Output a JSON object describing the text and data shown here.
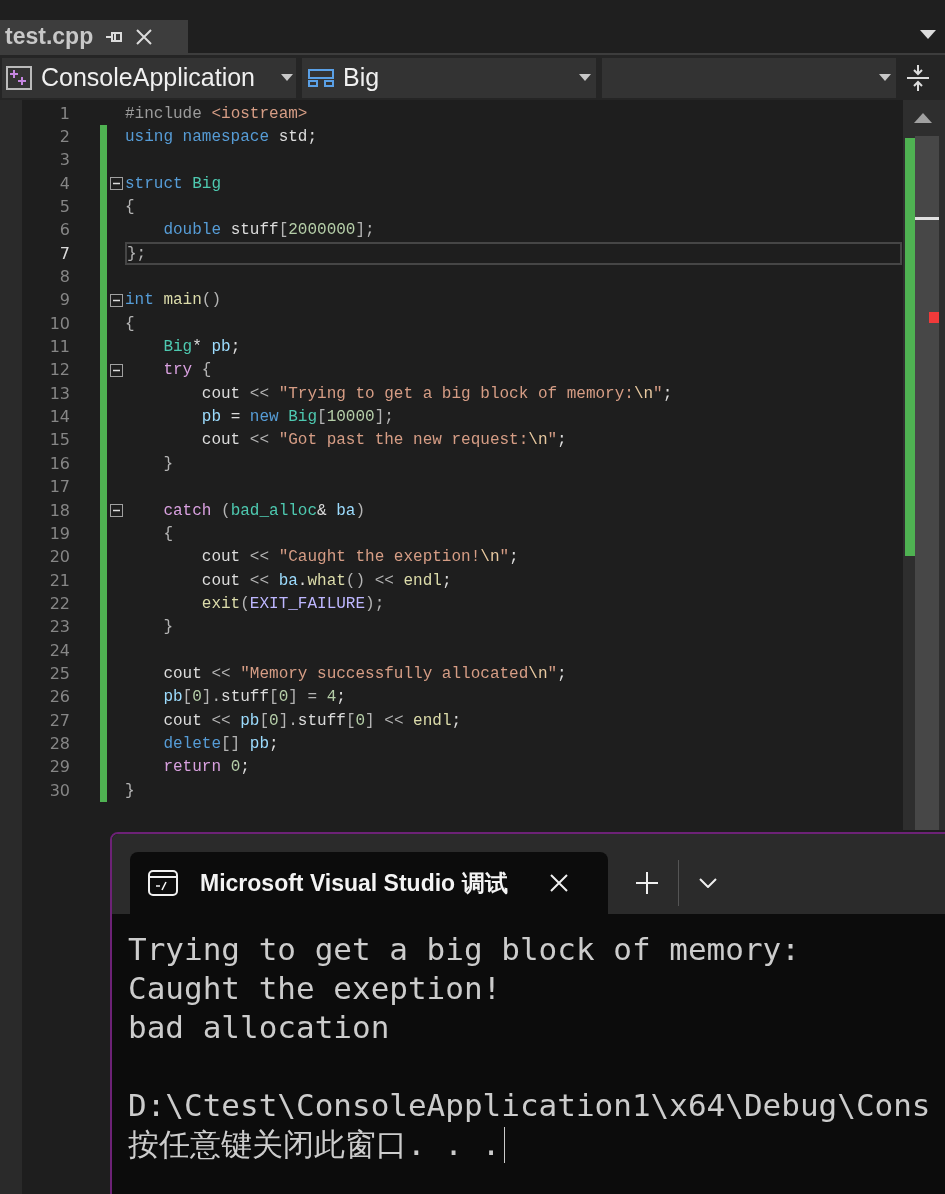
{
  "editor": {
    "tab": {
      "title": "test.cpp",
      "selected": true
    },
    "navigation_bar": {
      "project": "ConsoleApplication",
      "scope": "Big"
    },
    "lines": [
      {
        "number": "1",
        "changed": false,
        "tokens": [
          {
            "kind": "preproc",
            "text": "#include "
          },
          {
            "kind": "string",
            "text": "<iostream>"
          }
        ]
      },
      {
        "number": "2",
        "changed": true,
        "tokens": [
          {
            "kind": "keyword",
            "text": "using namespace "
          },
          {
            "kind": "plain",
            "text": "std;"
          }
        ]
      },
      {
        "number": "3",
        "changed": true
      },
      {
        "number": "4",
        "changed": true,
        "fold": true,
        "tokens": [
          {
            "kind": "keyword",
            "text": "struct "
          },
          {
            "kind": "type",
            "text": "Big"
          }
        ]
      },
      {
        "number": "5",
        "changed": true,
        "tokens": [
          {
            "kind": "punct",
            "text": "{"
          }
        ]
      },
      {
        "number": "6",
        "changed": true,
        "tokens": [
          {
            "kind": "keyword",
            "text": "    double "
          },
          {
            "kind": "plain",
            "text": "stuff"
          },
          {
            "kind": "punct",
            "text": "["
          },
          {
            "kind": "number",
            "text": "2000000"
          },
          {
            "kind": "punct",
            "text": "];"
          }
        ]
      },
      {
        "number": "7",
        "changed": true,
        "current": true,
        "tokens": [
          {
            "kind": "punct",
            "text": "};"
          }
        ]
      },
      {
        "number": "8",
        "changed": true
      },
      {
        "number": "9",
        "changed": true,
        "fold": true,
        "tokens": [
          {
            "kind": "keyword",
            "text": "int "
          },
          {
            "kind": "func",
            "text": "main"
          },
          {
            "kind": "punct",
            "text": "()"
          }
        ]
      },
      {
        "number": "10",
        "changed": true,
        "tokens": [
          {
            "kind": "punct",
            "text": "{"
          }
        ]
      },
      {
        "number": "11",
        "changed": true,
        "tokens": [
          {
            "kind": "type",
            "text": "    Big"
          },
          {
            "kind": "plain",
            "text": "* "
          },
          {
            "kind": "var",
            "text": "pb"
          },
          {
            "kind": "plain",
            "text": ";"
          }
        ]
      },
      {
        "number": "12",
        "changed": true,
        "fold": true,
        "tokens": [
          {
            "kind": "control",
            "text": "    try "
          },
          {
            "kind": "punct",
            "text": "{"
          }
        ]
      },
      {
        "number": "13",
        "changed": true,
        "tokens": [
          {
            "kind": "plain",
            "text": "        cout "
          },
          {
            "kind": "punct",
            "text": "<< "
          },
          {
            "kind": "string",
            "text": "\"Trying to get a big block of memory:"
          },
          {
            "kind": "escape",
            "text": "\\n"
          },
          {
            "kind": "string",
            "text": "\""
          },
          {
            "kind": "plain",
            "text": ";"
          }
        ]
      },
      {
        "number": "14",
        "changed": true,
        "tokens": [
          {
            "kind": "var",
            "text": "        pb "
          },
          {
            "kind": "plain",
            "text": "= "
          },
          {
            "kind": "keyword",
            "text": "new "
          },
          {
            "kind": "type",
            "text": "Big"
          },
          {
            "kind": "punct",
            "text": "["
          },
          {
            "kind": "number",
            "text": "10000"
          },
          {
            "kind": "punct",
            "text": "];"
          }
        ]
      },
      {
        "number": "15",
        "changed": true,
        "tokens": [
          {
            "kind": "plain",
            "text": "        cout "
          },
          {
            "kind": "punct",
            "text": "<< "
          },
          {
            "kind": "string",
            "text": "\"Got past the new request:"
          },
          {
            "kind": "escape",
            "text": "\\n"
          },
          {
            "kind": "string",
            "text": "\""
          },
          {
            "kind": "plain",
            "text": ";"
          }
        ]
      },
      {
        "number": "16",
        "changed": true,
        "tokens": [
          {
            "kind": "punct",
            "text": "    }"
          }
        ]
      },
      {
        "number": "17",
        "changed": true
      },
      {
        "number": "18",
        "changed": true,
        "fold": true,
        "tokens": [
          {
            "kind": "control",
            "text": "    catch "
          },
          {
            "kind": "punct",
            "text": "("
          },
          {
            "kind": "type",
            "text": "bad_alloc"
          },
          {
            "kind": "plain",
            "text": "& "
          },
          {
            "kind": "var",
            "text": "ba"
          },
          {
            "kind": "punct",
            "text": ")"
          }
        ]
      },
      {
        "number": "19",
        "changed": true,
        "tokens": [
          {
            "kind": "punct",
            "text": "    {"
          }
        ]
      },
      {
        "number": "20",
        "changed": true,
        "tokens": [
          {
            "kind": "plain",
            "text": "        cout "
          },
          {
            "kind": "punct",
            "text": "<< "
          },
          {
            "kind": "string",
            "text": "\"Caught the exeption!"
          },
          {
            "kind": "escape",
            "text": "\\n"
          },
          {
            "kind": "string",
            "text": "\""
          },
          {
            "kind": "plain",
            "text": ";"
          }
        ]
      },
      {
        "number": "21",
        "changed": true,
        "tokens": [
          {
            "kind": "plain",
            "text": "        cout "
          },
          {
            "kind": "punct",
            "text": "<< "
          },
          {
            "kind": "var",
            "text": "ba"
          },
          {
            "kind": "plain",
            "text": "."
          },
          {
            "kind": "func",
            "text": "what"
          },
          {
            "kind": "punct",
            "text": "() << "
          },
          {
            "kind": "func",
            "text": "endl"
          },
          {
            "kind": "plain",
            "text": ";"
          }
        ]
      },
      {
        "number": "22",
        "changed": true,
        "tokens": [
          {
            "kind": "func",
            "text": "        exit"
          },
          {
            "kind": "punct",
            "text": "("
          },
          {
            "kind": "macro",
            "text": "EXIT_FAILURE"
          },
          {
            "kind": "punct",
            "text": ");"
          }
        ]
      },
      {
        "number": "23",
        "changed": true,
        "tokens": [
          {
            "kind": "punct",
            "text": "    }"
          }
        ]
      },
      {
        "number": "24",
        "changed": true
      },
      {
        "number": "25",
        "changed": true,
        "tokens": [
          {
            "kind": "plain",
            "text": "    cout "
          },
          {
            "kind": "punct",
            "text": "<< "
          },
          {
            "kind": "string",
            "text": "\"Memory successfully allocated"
          },
          {
            "kind": "escape",
            "text": "\\n"
          },
          {
            "kind": "string",
            "text": "\""
          },
          {
            "kind": "plain",
            "text": ";"
          }
        ]
      },
      {
        "number": "26",
        "changed": true,
        "tokens": [
          {
            "kind": "var",
            "text": "    pb"
          },
          {
            "kind": "punct",
            "text": "["
          },
          {
            "kind": "number",
            "text": "0"
          },
          {
            "kind": "punct",
            "text": "]."
          },
          {
            "kind": "plain",
            "text": "stuff"
          },
          {
            "kind": "punct",
            "text": "["
          },
          {
            "kind": "number",
            "text": "0"
          },
          {
            "kind": "punct",
            "text": "] = "
          },
          {
            "kind": "number",
            "text": "4"
          },
          {
            "kind": "plain",
            "text": ";"
          }
        ]
      },
      {
        "number": "27",
        "changed": true,
        "tokens": [
          {
            "kind": "plain",
            "text": "    cout "
          },
          {
            "kind": "punct",
            "text": "<< "
          },
          {
            "kind": "var",
            "text": "pb"
          },
          {
            "kind": "punct",
            "text": "["
          },
          {
            "kind": "number",
            "text": "0"
          },
          {
            "kind": "punct",
            "text": "]."
          },
          {
            "kind": "plain",
            "text": "stuff"
          },
          {
            "kind": "punct",
            "text": "["
          },
          {
            "kind": "number",
            "text": "0"
          },
          {
            "kind": "punct",
            "text": "] << "
          },
          {
            "kind": "func",
            "text": "endl"
          },
          {
            "kind": "plain",
            "text": ";"
          }
        ]
      },
      {
        "number": "28",
        "changed": true,
        "tokens": [
          {
            "kind": "keyword",
            "text": "    delete"
          },
          {
            "kind": "punct",
            "text": "[] "
          },
          {
            "kind": "var",
            "text": "pb"
          },
          {
            "kind": "plain",
            "text": ";"
          }
        ]
      },
      {
        "number": "29",
        "changed": true,
        "tokens": [
          {
            "kind": "control",
            "text": "    return "
          },
          {
            "kind": "number",
            "text": "0"
          },
          {
            "kind": "plain",
            "text": ";"
          }
        ]
      },
      {
        "number": "30",
        "changed": true,
        "tokens": [
          {
            "kind": "punct",
            "text": "}"
          }
        ]
      }
    ]
  },
  "console": {
    "tab": {
      "title": "Microsoft Visual Studio 调试",
      "selected": true
    },
    "output_blocks": [
      {
        "lines": [
          "Trying to get a big block of memory:",
          "Caught the exeption!",
          "bad allocation"
        ]
      },
      {
        "lines": [
          "D:\\Ctest\\ConsoleApplication1\\x64\\Debug\\Cons",
          "按任意键关闭此窗口. . ."
        ]
      }
    ],
    "cursor": true
  }
}
